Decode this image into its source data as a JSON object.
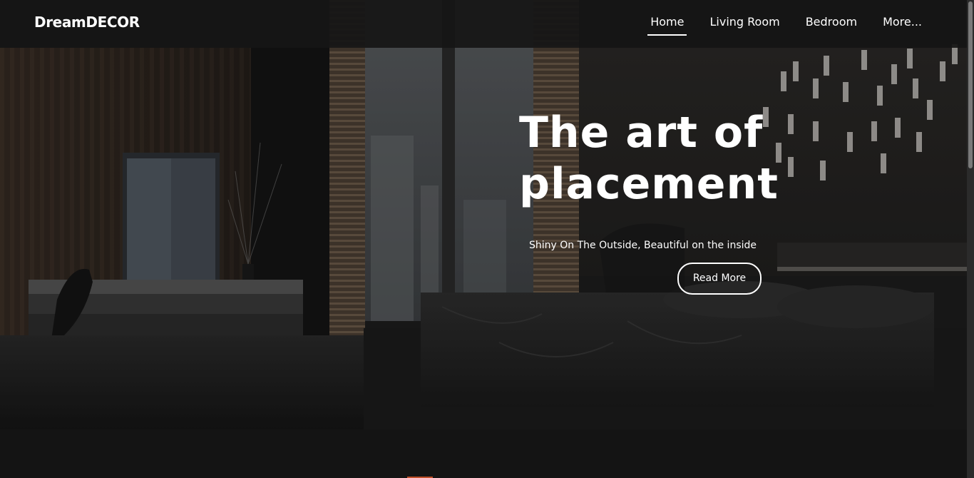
{
  "brand": {
    "name": "DreamDECOR"
  },
  "nav": {
    "items": [
      {
        "label": "Home",
        "active": true
      },
      {
        "label": "Living Room",
        "active": false
      },
      {
        "label": "Bedroom",
        "active": false
      },
      {
        "label": "More...",
        "active": false
      }
    ]
  },
  "hero": {
    "title": "The art of\nplacement",
    "subtitle": "Shiny On The Outside, Beautiful on the inside",
    "button_label": "Read More",
    "image_description_icon": "bedroom-photo"
  },
  "colors": {
    "background": "#141414",
    "navbar": "#161616",
    "text": "#ffffff",
    "accent": "#c0502a"
  }
}
